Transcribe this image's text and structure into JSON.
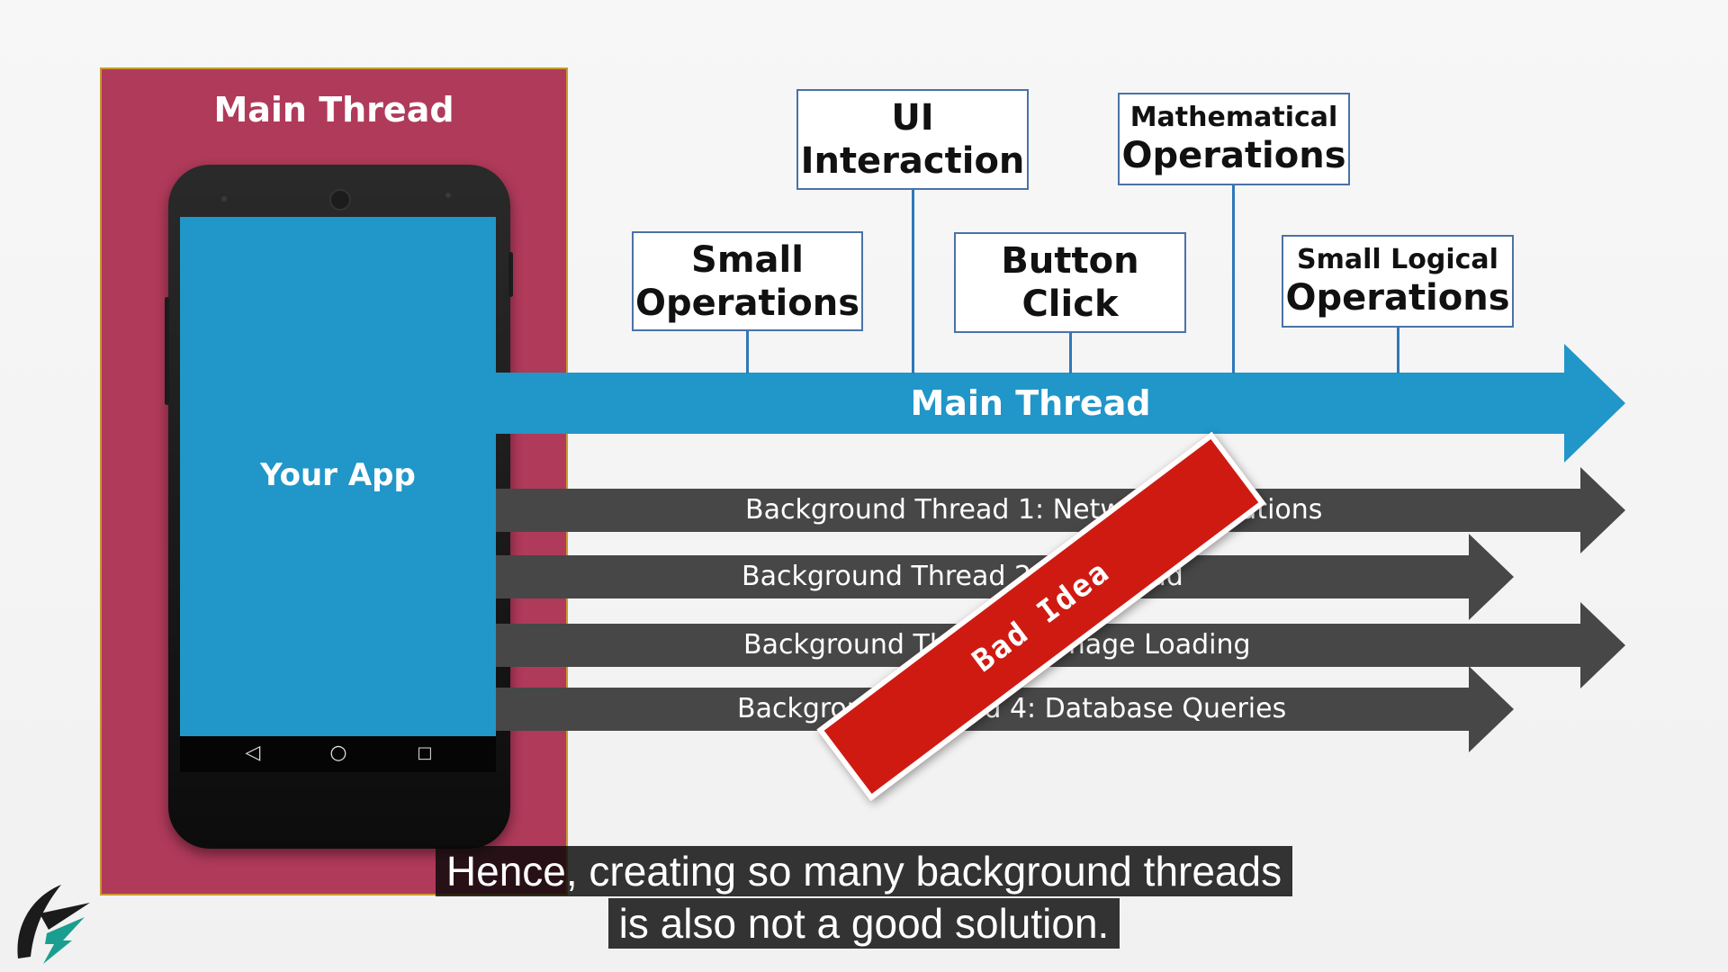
{
  "panel": {
    "title": "Main Thread",
    "app_label": "Your App"
  },
  "main_arrow": {
    "label": "Main Thread"
  },
  "operations": {
    "ui_interaction": [
      "UI",
      "Interaction"
    ],
    "mathematical": [
      "Mathematical",
      "Operations"
    ],
    "small": [
      "Small",
      "Operations"
    ],
    "button_click": [
      "Button",
      "Click"
    ],
    "small_logical": [
      "Small Logical",
      "Operations"
    ]
  },
  "background_threads": [
    "Background Thread 1: Network Operations",
    "Background Thread 2: Download",
    "Background Thread 3: Image Loading",
    "Background Thread 4: Database Queries"
  ],
  "banner": {
    "text": "Bad Idea"
  },
  "captions": [
    "Hence, creating so many background threads",
    "is also not a good solution."
  ],
  "icons": {
    "back": "back-triangle",
    "home": "home-circle",
    "recents": "recents-square"
  },
  "colors": {
    "panel": "#b03a5a",
    "main_thread": "#2196c8",
    "background_thread": "#474747",
    "banner": "#cf1a12"
  }
}
